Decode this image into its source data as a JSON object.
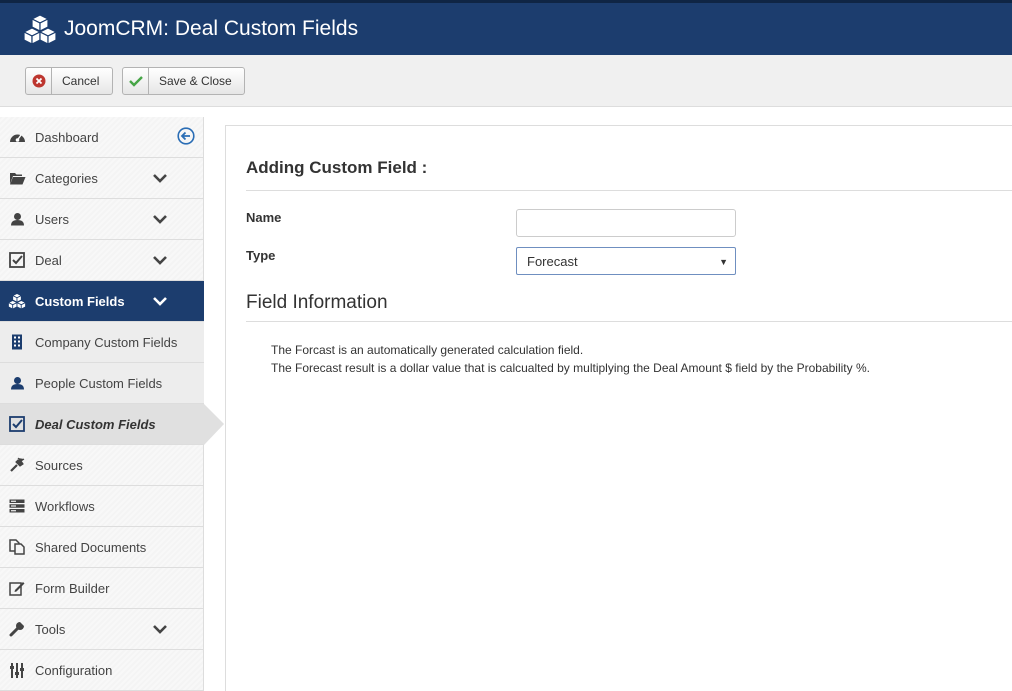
{
  "header": {
    "title": "JoomCRM: Deal Custom Fields",
    "logo_icon": "cubes-icon",
    "bg_color": "#1c3d6e"
  },
  "toolbar": {
    "cancel_label": "Cancel",
    "cancel_icon": "cancel-circle-icon",
    "save_label": "Save & Close",
    "save_icon": "checkmark-icon"
  },
  "sidebar": {
    "items": [
      {
        "label": "Dashboard",
        "icon": "dashboard-icon"
      },
      {
        "label": "Categories",
        "icon": "folder-open-icon"
      },
      {
        "label": "Users",
        "icon": "user-icon"
      },
      {
        "label": "Deal",
        "icon": "checkbox-icon"
      },
      {
        "label": "Custom Fields",
        "icon": "cubes-icon"
      },
      {
        "label": "Company Custom Fields",
        "icon": "building-icon"
      },
      {
        "label": "People Custom Fields",
        "icon": "user-icon"
      },
      {
        "label": "Deal Custom Fields",
        "icon": "checkbox-icon"
      },
      {
        "label": "Sources",
        "icon": "plug-icon"
      },
      {
        "label": "Workflows",
        "icon": "server-icon"
      },
      {
        "label": "Shared Documents",
        "icon": "copy-icon"
      },
      {
        "label": "Form Builder",
        "icon": "edit-icon"
      },
      {
        "label": "Tools",
        "icon": "wrench-icon"
      },
      {
        "label": "Configuration",
        "icon": "sliders-icon"
      }
    ],
    "active_color": "#1c3d6e"
  },
  "main": {
    "heading": "Adding Custom Field :",
    "name_label": "Name",
    "name_value": "",
    "type_label": "Type",
    "type_value": "Forecast",
    "section_title": "Field Information",
    "info_line1": "The Forcast is an automatically generated calculation field.",
    "info_line2": "The Forecast result is a dollar value that is calcualted by multiplying the Deal Amount $ field by the Probability %."
  }
}
